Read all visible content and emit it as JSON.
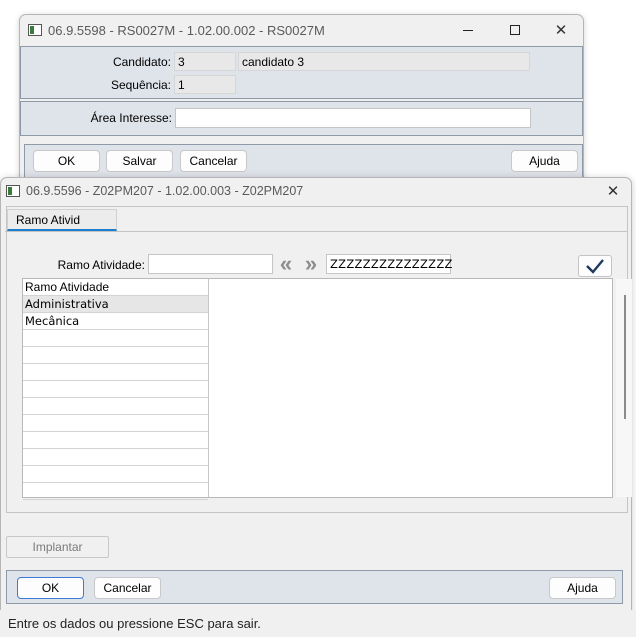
{
  "window_back": {
    "title": "06.9.5598 - RS0027M - 1.02.00.002 - RS0027M",
    "fields": {
      "candidato_label": "Candidato:",
      "candidato_code": "3",
      "candidato_name": "candidato 3",
      "sequencia_label": "Sequência:",
      "sequencia_value": "1",
      "area_label": "Área Interesse:",
      "area_value": ""
    },
    "buttons": {
      "ok": "OK",
      "salvar": "Salvar",
      "cancelar": "Cancelar",
      "ajuda": "Ajuda"
    }
  },
  "window_front": {
    "title": "06.9.5596 - Z02PM207 - 1.02.00.003 - Z02PM207",
    "tab_label": "Ramo Ativid",
    "filter": {
      "label": "Ramo Atividade:",
      "from_value": "",
      "to_value": "ZZZZZZZZZZZZZZZ"
    },
    "grid": {
      "column_header": "Ramo Atividade",
      "rows": [
        "Administrativa",
        "Mecânica",
        "",
        "",
        "",
        "",
        "",
        "",
        "",
        "",
        "",
        ""
      ]
    },
    "buttons": {
      "implantar": "Implantar",
      "ok": "OK",
      "cancelar": "Cancelar",
      "ajuda": "Ajuda"
    }
  },
  "status_bar": "Entre os dados ou pressione ESC para sair.",
  "icons": {
    "window": "window-icon",
    "minimize": "minimize-icon",
    "maximize": "maximize-icon",
    "close": "close-icon",
    "prev": "double-chevron-left-icon",
    "next": "double-chevron-right-icon",
    "confirm": "checkmark-icon"
  }
}
